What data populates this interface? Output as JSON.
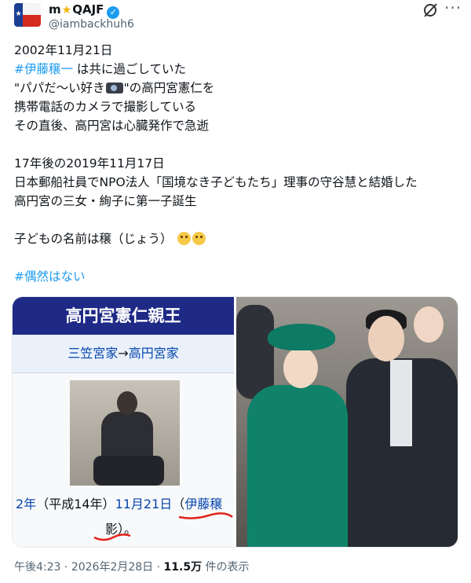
{
  "author": {
    "name_prefix": "m",
    "name_suffix": "QAJF",
    "verified_mark": "✓",
    "handle": "@iambackhuh6",
    "flag_icon": "texas-flag-icon"
  },
  "tweet": {
    "line1": "2002年11月21日",
    "hashtag1": "#伊藤穣一",
    "line2_rest": " は共に過ごしていた",
    "line3_a": "\"パパだ〜い好き",
    "line3_b": "\"の高円宮憲仁を",
    "line4": "携帯電話のカメラで撮影している",
    "line5": "その直後、高円宮は心臓発作で急逝",
    "line6": "17年後の2019年11月17日",
    "line7": "日本郵船社員でNPO法人「国境なき子どもたち」理事の守谷慧と結婚した",
    "line8": "高円宮の三女・絢子に第一子誕生",
    "line9": "子どもの名前は穣（じょう）",
    "hashtag2": "#偶然はない"
  },
  "media": {
    "wiki_title": "高円宮憲仁親王",
    "wiki_link1": "三笠宮家",
    "wiki_arrow": "→",
    "wiki_link2": "高円宮家",
    "caption_a": "2年",
    "caption_b": "（平成14年）",
    "caption_c": "11月21日",
    "caption_d": "（",
    "caption_e": "伊藤穣",
    "caption_f": "影",
    "caption_g": "）。"
  },
  "meta": {
    "time": "午後4:23",
    "sep1": " · ",
    "date": "2026年2月28日",
    "sep2": " · ",
    "views": "11.5万",
    "views_label": " 件の表示"
  },
  "colors": {
    "link": "#1d9bf0",
    "wiki_header": "#1f2a86",
    "wiki_link": "#0645ad",
    "annotation": "#e0241b"
  }
}
